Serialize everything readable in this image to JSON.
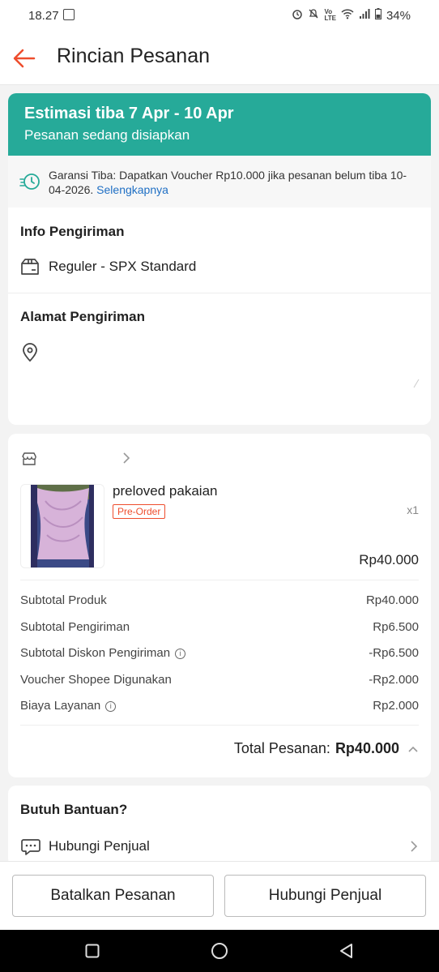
{
  "status_bar": {
    "time": "18.27",
    "battery": "34%"
  },
  "header": {
    "title": "Rincian Pesanan"
  },
  "banner": {
    "eta": "Estimasi tiba 7 Apr - 10 Apr",
    "status": "Pesanan sedang disiapkan"
  },
  "guarantee": {
    "text": "Garansi Tiba: Dapatkan Voucher Rp10.000 jika pesanan belum tiba 10-04-2026.",
    "link": "Selengkapnya"
  },
  "shipping": {
    "title": "Info Pengiriman",
    "method": "Reguler - SPX Standard"
  },
  "address": {
    "title": "Alamat Pengiriman"
  },
  "order": {
    "product_name": "preloved pakaian",
    "badge": "Pre-Order",
    "qty": "x1",
    "price": "Rp40.000",
    "summary": [
      {
        "label": "Subtotal Produk",
        "value": "Rp40.000"
      },
      {
        "label": "Subtotal Pengiriman",
        "value": "Rp6.500"
      },
      {
        "label": "Subtotal Diskon Pengiriman",
        "value": "-Rp6.500"
      },
      {
        "label": "Voucher Shopee Digunakan",
        "value": "-Rp2.000"
      },
      {
        "label": "Biaya Layanan",
        "value": "Rp2.000"
      }
    ],
    "total_label": "Total Pesanan:",
    "total_value": "Rp40.000"
  },
  "help": {
    "title": "Butuh Bantuan?",
    "contact": "Hubungi Penjual"
  },
  "bottom": {
    "cancel": "Batalkan Pesanan",
    "contact": "Hubungi Penjual"
  },
  "colors": {
    "accent": "#ee4d2d",
    "banner": "#26aa99",
    "link": "#1f6fc4"
  }
}
